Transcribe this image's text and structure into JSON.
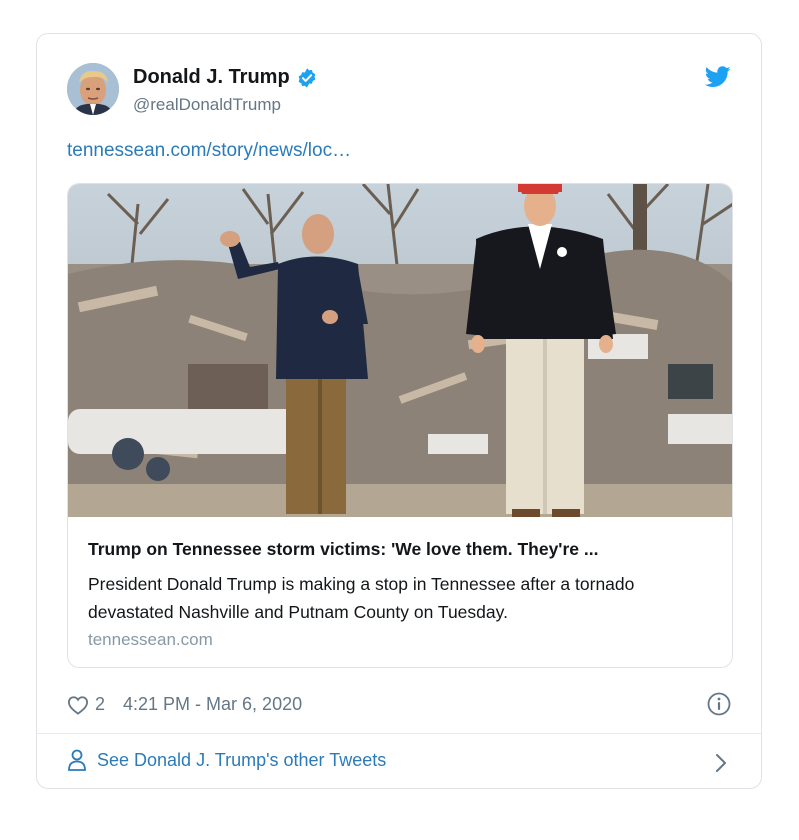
{
  "tweet": {
    "author_name": "Donald J. Trump",
    "author_handle": "@realDonaldTrump",
    "link_text": "tennessean.com/story/news/loc…",
    "like_count": "2",
    "timestamp": "4:21 PM - Mar 6, 2020"
  },
  "card": {
    "title": "Trump on Tennessee storm victims: 'We love them. They're ...",
    "description": "President Donald Trump is making a stop in Tennessee after a tornado devastated Nashville and Putnam County on Tuesday.",
    "domain": "tennessean.com"
  },
  "footer": {
    "other_tweets_label": "See Donald J. Trump's other Tweets"
  },
  "icons": {
    "verified": "verified-badge-icon",
    "brand": "twitter-bird-icon",
    "like": "heart-icon",
    "info": "info-icon",
    "profile": "person-icon",
    "next": "chevron-right-icon"
  },
  "colors": {
    "accent": "#1da1f2",
    "link": "#2b7bb9",
    "muted": "#657786",
    "border": "#dfe3e8"
  }
}
